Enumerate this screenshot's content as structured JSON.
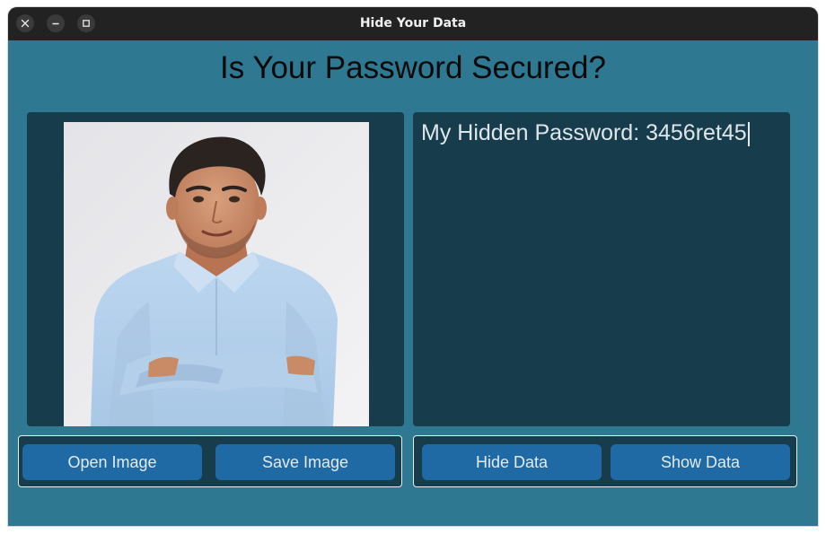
{
  "window": {
    "title": "Hide Your Data"
  },
  "heading": "Is Your Password Secured?",
  "text_panel": {
    "content": "My Hidden Password: 3456ret45"
  },
  "image_buttons": {
    "open_label": "Open Image",
    "save_label": "Save Image"
  },
  "data_buttons": {
    "hide_label": "Hide Data",
    "show_label": "Show Data"
  },
  "icons": {
    "close": "close-icon",
    "minimize": "minimize-icon",
    "maximize": "maximize-icon"
  },
  "colors": {
    "window_bg": "#2f7891",
    "panel_bg": "#173c4c",
    "button_bg": "#1f6aa5",
    "titlebar_bg": "#222222"
  }
}
